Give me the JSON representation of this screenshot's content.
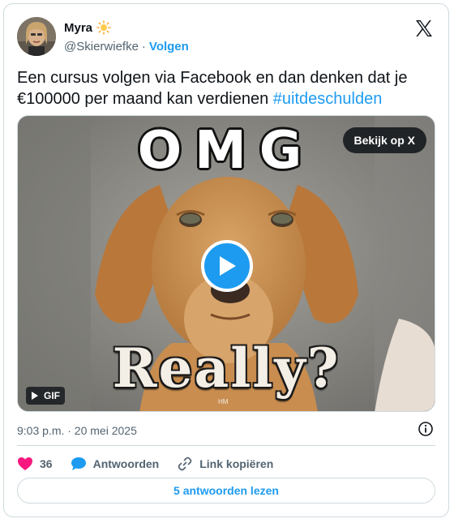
{
  "author": {
    "name": "Myra",
    "name_emoji_icon": "sun-icon",
    "handle": "@Skierwiefke",
    "separator": "·",
    "follow_label": "Volgen"
  },
  "platform_icon": "x-logo-icon",
  "tweet": {
    "text": "Een cursus volgen via Facebook en dan denken dat je €100000 per maand kan verdienen ",
    "hashtag": "#uitdeschulden"
  },
  "media": {
    "top_caption": "OMG",
    "bottom_caption": "Really?",
    "watermark": "HM",
    "view_on_x_label": "Bekijk op X",
    "badge_label": "GIF"
  },
  "timestamp": "9:03 p.m. · 20 mei 2025",
  "actions": {
    "like_count": "36",
    "reply_label": "Antwoorden",
    "copy_link_label": "Link kopiëren"
  },
  "read_replies_label": "5 antwoorden lezen",
  "colors": {
    "accent": "#1d9bf0",
    "like": "#f91880",
    "text": "#0f1419",
    "muted": "#536471",
    "border": "#cfd9de"
  }
}
